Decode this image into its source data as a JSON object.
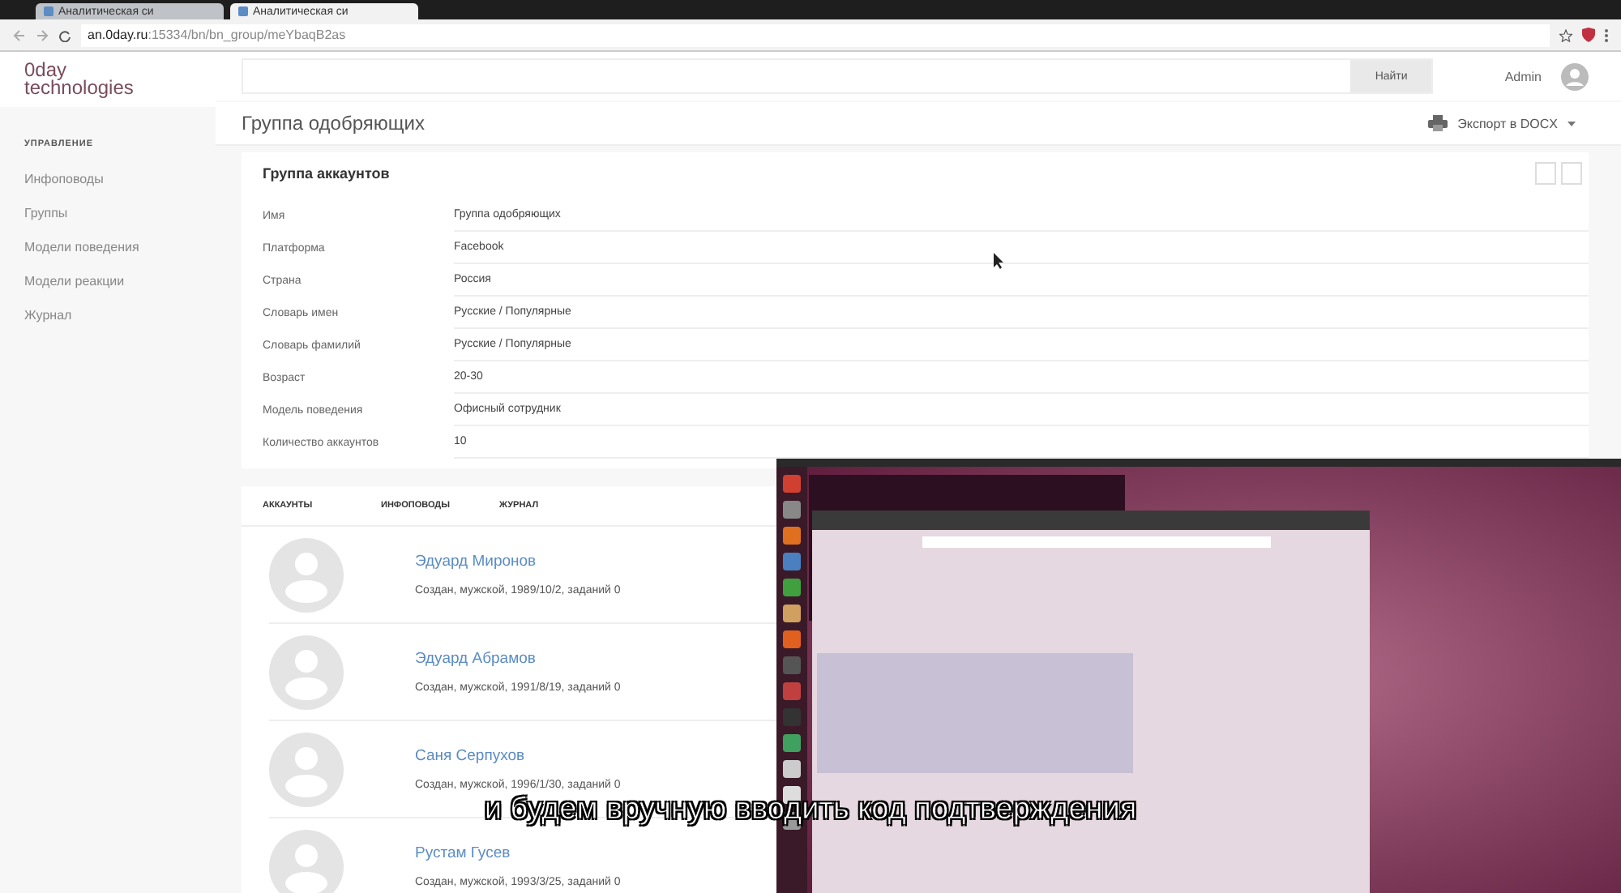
{
  "browser": {
    "tabs": [
      {
        "title": "Аналитическая си",
        "selected": false
      },
      {
        "title": "Аналитическая си",
        "selected": true
      }
    ],
    "url": {
      "host": "an.0day.ru",
      "path": ":15334/bn/bn_group/meYbaqB2as"
    }
  },
  "logo": [
    "0day",
    "technologies"
  ],
  "search": {
    "button": "Найти"
  },
  "user": "Admin",
  "sidebar": {
    "section": "УПРАВЛЕНИЕ",
    "items": [
      "Инфоповоды",
      "Группы",
      "Модели поведения",
      "Модели реакции",
      "Журнал"
    ]
  },
  "page_title": "Группа одобряющих",
  "export": "Экспорт в DOCX",
  "card": {
    "title": "Группа аккаунтов",
    "fields": [
      {
        "label": "Имя",
        "value": "Группа одобряющих"
      },
      {
        "label": "Платформа",
        "value": "Facebook"
      },
      {
        "label": "Страна",
        "value": "Россия"
      },
      {
        "label": "Словарь имен",
        "value": "Русские / Популярные"
      },
      {
        "label": "Словарь фамилий",
        "value": "Русские / Популярные"
      },
      {
        "label": "Возраст",
        "value": "20-30"
      },
      {
        "label": "Модель поведения",
        "value": "Офисный сотрудник"
      },
      {
        "label": "Количество аккаунтов",
        "value": "10"
      }
    ]
  },
  "tabs": [
    "АККАУНТЫ",
    "ИНФОПОВОДЫ",
    "ЖУРНАЛ"
  ],
  "accounts": [
    {
      "name": "Эдуард Миронов",
      "details": "Создан, мужской, 1989/10/2, заданий 0"
    },
    {
      "name": "Эдуард Абрамов",
      "details": "Создан, мужской, 1991/8/19, заданий 0"
    },
    {
      "name": "Саня Серпухов",
      "details": "Создан, мужской, 1996/1/30, заданий 0"
    },
    {
      "name": "Рустам Гусев",
      "details": "Создан, мужской, 1993/3/25, заданий 0"
    }
  ],
  "subtitle": "и будем вручную вводить код подтверждения"
}
